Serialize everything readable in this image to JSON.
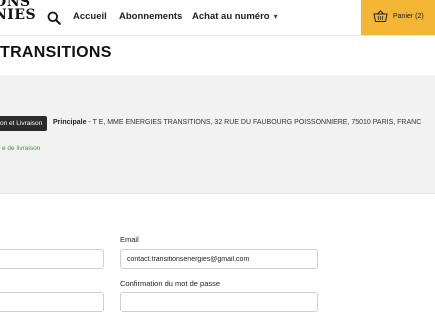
{
  "header": {
    "logo_text": "ONS\nNIES",
    "nav": {
      "home": "Accueil",
      "subscriptions": "Abonnements",
      "buy_issue": "Achat au numéro"
    },
    "cart_label": "Panier (2)"
  },
  "page_title": "TRANSITIONS",
  "address": {
    "badge_label": "on et Livraison",
    "label_bold": "Principale",
    "text": " - T E, MME ENERGIES TRANSITIONS, 32 RUE DU FAUBOURG POISSONNIERE, 75010 PARIS, FRANC",
    "link": "e de livraison"
  },
  "form": {
    "email_label": "Email",
    "email_value": "contact.transitionsenergies@gmail.com",
    "confirm_password_label": "Confirmation du mot de passe",
    "left_field_value": "",
    "left_field2_value": "",
    "confirm_value": ""
  },
  "colors": {
    "cart_bg": "#f2b534",
    "link": "#3a9a3a",
    "band_bg": "#f2f2f2",
    "badge_bg": "#2b2b2b"
  },
  "icons": [
    "search-icon",
    "basket-icon",
    "chevron-down-icon"
  ]
}
